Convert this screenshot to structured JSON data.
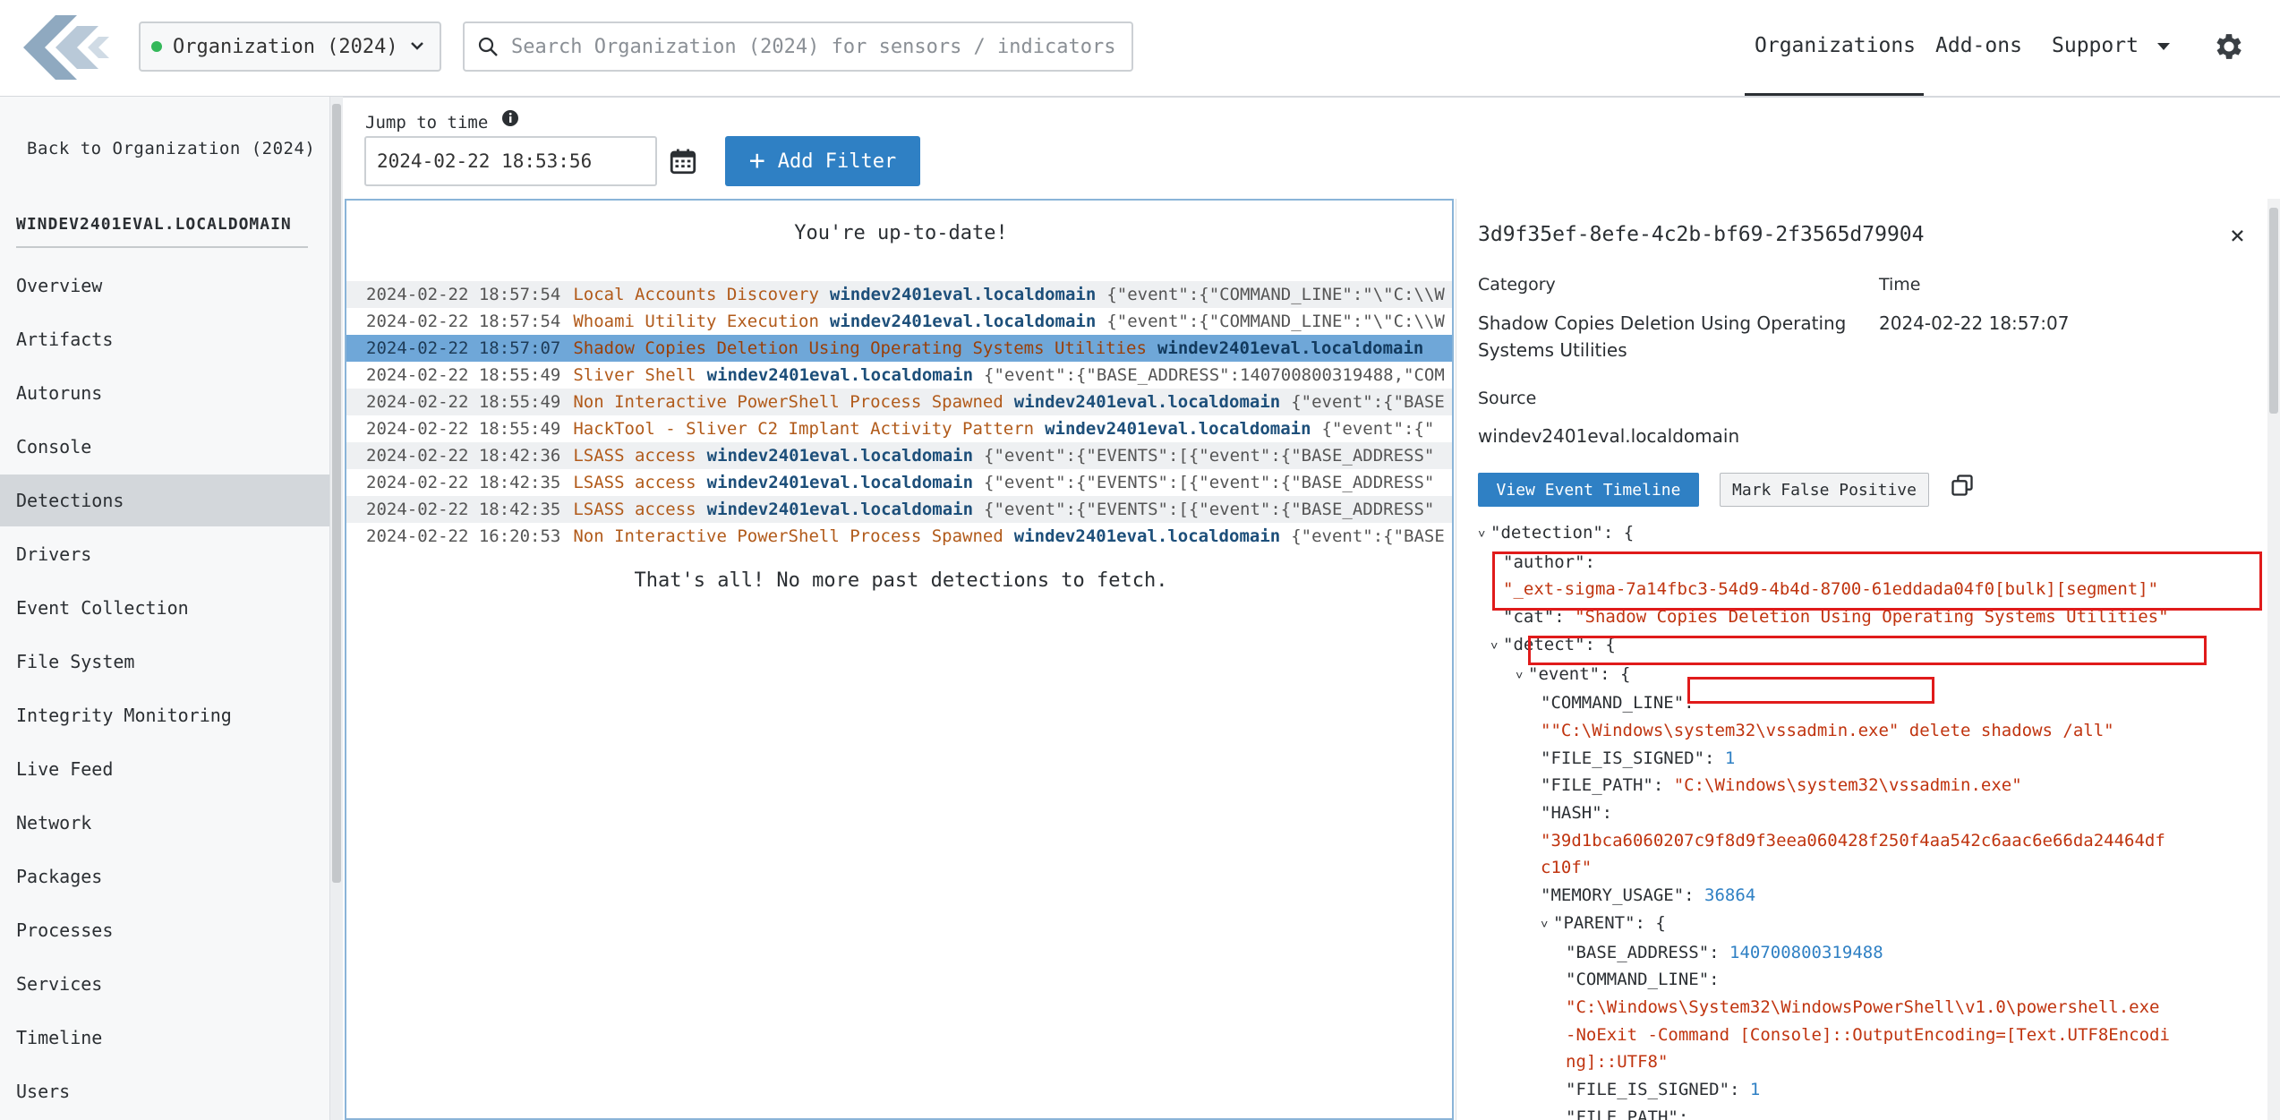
{
  "topbar": {
    "org_name": "Organization (2024)",
    "search_placeholder": "Search Organization (2024) for sensors / indicators...",
    "nav": {
      "organizations": "Organizations",
      "addons": "Add-ons",
      "support": "Support"
    },
    "status_color": "#34b85a"
  },
  "sidebar": {
    "back": "Back to Organization (2024)",
    "host": "WINDEV2401EVAL.LOCALDOMAIN",
    "items": [
      "Overview",
      "Artifacts",
      "Autoruns",
      "Console",
      "Detections",
      "Drivers",
      "Event Collection",
      "File System",
      "Integrity Monitoring",
      "Live Feed",
      "Network",
      "Packages",
      "Processes",
      "Services",
      "Timeline",
      "Users"
    ],
    "active": "Detections"
  },
  "toolbar": {
    "jump_label": "Jump to time",
    "time_value": "2024-02-22 18:53:56",
    "add_filter": "Add Filter"
  },
  "list": {
    "uptodate": "You're up-to-date!",
    "end_text": "That's all! No more past detections to fetch.",
    "rows": [
      {
        "ts": "2024-02-22 18:57:54",
        "cat": "Local Accounts Discovery",
        "host": "windev2401eval.localdomain",
        "json": "{\"event\":{\"COMMAND_LINE\":\"\\\"C:\\\\W"
      },
      {
        "ts": "2024-02-22 18:57:54",
        "cat": "Whoami Utility Execution",
        "host": "windev2401eval.localdomain",
        "json": "{\"event\":{\"COMMAND_LINE\":\"\\\"C:\\\\W"
      },
      {
        "ts": "2024-02-22 18:57:07",
        "cat": "Shadow Copies Deletion Using Operating Systems Utilities",
        "host": "windev2401eval.localdomain",
        "json": ""
      },
      {
        "ts": "2024-02-22 18:55:49",
        "cat": "Sliver Shell",
        "host": "windev2401eval.localdomain",
        "json": "{\"event\":{\"BASE_ADDRESS\":140700800319488,\"COM"
      },
      {
        "ts": "2024-02-22 18:55:49",
        "cat": "Non Interactive PowerShell Process Spawned",
        "host": "windev2401eval.localdomain",
        "json": "{\"event\":{\"BASE"
      },
      {
        "ts": "2024-02-22 18:55:49",
        "cat": "HackTool - Sliver C2 Implant Activity Pattern",
        "host": "windev2401eval.localdomain",
        "json": "{\"event\":{\""
      },
      {
        "ts": "2024-02-22 18:42:36",
        "cat": "LSASS access",
        "host": "windev2401eval.localdomain",
        "json": "{\"event\":{\"EVENTS\":[{\"event\":{\"BASE_ADDRESS\""
      },
      {
        "ts": "2024-02-22 18:42:35",
        "cat": "LSASS access",
        "host": "windev2401eval.localdomain",
        "json": "{\"event\":{\"EVENTS\":[{\"event\":{\"BASE_ADDRESS\""
      },
      {
        "ts": "2024-02-22 18:42:35",
        "cat": "LSASS access",
        "host": "windev2401eval.localdomain",
        "json": "{\"event\":{\"EVENTS\":[{\"event\":{\"BASE_ADDRESS\""
      },
      {
        "ts": "2024-02-22 16:20:53",
        "cat": "Non Interactive PowerShell Process Spawned",
        "host": "windev2401eval.localdomain",
        "json": "{\"event\":{\"BASE"
      }
    ],
    "selected_index": 2
  },
  "detail": {
    "id": "3d9f35ef-8efe-4c2b-bf69-2f3565d79904",
    "category_label": "Category",
    "category_value": "Shadow Copies Deletion Using Operating Systems Utilities",
    "time_label": "Time",
    "time_value": "2024-02-22 18:57:07",
    "source_label": "Source",
    "source_value": "windev2401eval.localdomain",
    "btn_timeline": "View Event Timeline",
    "btn_false_positive": "Mark False Positive",
    "tree": {
      "detection": "\"detection\": {",
      "author_key": "\"author\":",
      "author_val": "\"_ext-sigma-7a14fbc3-54d9-4b4d-8700-61eddada04f0[bulk][segment]\"",
      "cat_key": "\"cat\":",
      "cat_val": "\"Shadow Copies Deletion Using Operating Systems Utilities\"",
      "detect": "\"detect\": {",
      "event": "\"event\": {",
      "cmd_key": "\"COMMAND_LINE\":",
      "cmd_val": "\"\"C:\\Windows\\system32\\vssadmin.exe\" delete shadows /all\"",
      "signed_key": "\"FILE_IS_SIGNED\":",
      "signed_val": "1",
      "path_key": "\"FILE_PATH\":",
      "path_val": "\"C:\\Windows\\system32\\vssadmin.exe\"",
      "hash_key": "\"HASH\":",
      "hash_val_1": "\"39d1bca6060207c9f8d9f3eea060428f250f4aa542c6aac6e66da24464df",
      "hash_val_2": "c10f\"",
      "mem_key": "\"MEMORY_USAGE\":",
      "mem_val": "36864",
      "parent": "\"PARENT\": {",
      "base_key": "\"BASE_ADDRESS\":",
      "base_val": "140700800319488",
      "pcmd_key": "\"COMMAND_LINE\":",
      "pcmd_val_1": "\"C:\\Windows\\System32\\WindowsPowerShell\\v1.0\\powershell.exe",
      "pcmd_val_2": "-NoExit -Command [Console]::OutputEncoding=[Text.UTF8Encodi",
      "pcmd_val_3": "ng]::UTF8\"",
      "psigned_key": "\"FILE_IS_SIGNED\":",
      "psigned_val": "1",
      "ppath_key": "\"FILE_PATH\":"
    }
  }
}
